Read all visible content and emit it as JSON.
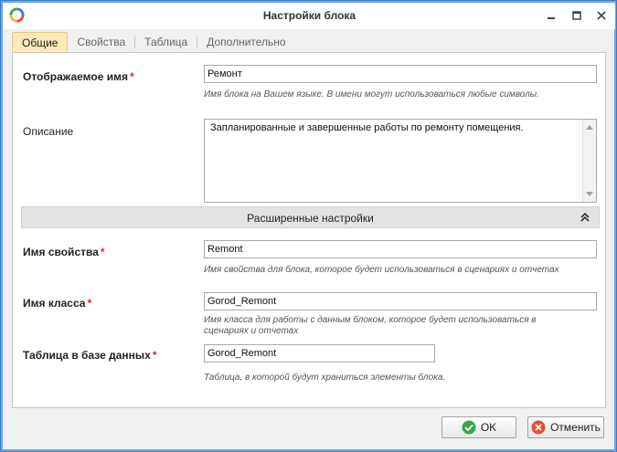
{
  "window": {
    "title": "Настройки блока"
  },
  "tabs": [
    {
      "label": "Общие",
      "active": true
    },
    {
      "label": "Свойства",
      "active": false
    },
    {
      "label": "Таблица",
      "active": false
    },
    {
      "label": "Дополнительно",
      "active": false
    }
  ],
  "fields": {
    "display_name": {
      "label": "Отображаемое имя",
      "required_mark": "*",
      "value": "Ремонт",
      "hint": "Имя блока на Вашем языке. В имени могут использоваться любые символы."
    },
    "description": {
      "label": "Описание",
      "value": "Запланированные и завершенные работы по ремонту помещения."
    },
    "advanced_section": {
      "title": "Расширенные настройки"
    },
    "property_name": {
      "label": "Имя свойства",
      "required_mark": "*",
      "value": "Remont",
      "hint": "Имя свойства для блока, которое будет использоваться в сценариях и отчетах"
    },
    "class_name": {
      "label": "Имя класса",
      "required_mark": "*",
      "value": "Gorod_Remont",
      "hint_line1": "Имя класса для работы с данным блоком, которое будет использоваться в",
      "hint_line2": "сценариях и отчетах"
    },
    "db_table": {
      "label": "Таблица в базе данных",
      "required_mark": "*",
      "value": "Gorod_Remont",
      "hint": "Таблица, в которой будут храниться элементы блока."
    }
  },
  "buttons": {
    "ok_label": "OK",
    "cancel_label": "Отменить"
  },
  "colors": {
    "accent_tab": "#fbe9b7",
    "required": "#d0302a",
    "ok_icon": "#3aa548",
    "cancel_icon": "#e0503c"
  }
}
